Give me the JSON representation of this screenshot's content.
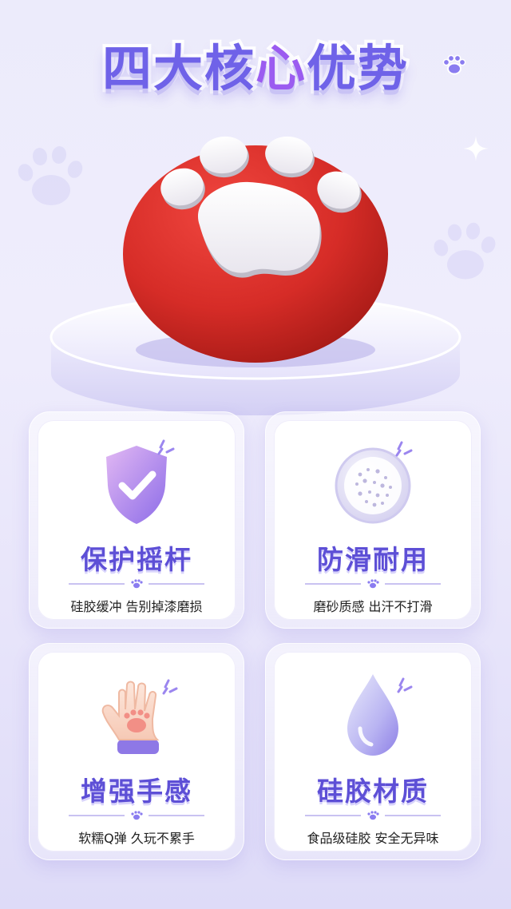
{
  "title": {
    "part1": "四大核",
    "highlight": "心",
    "part2": "优势"
  },
  "colors": {
    "accent": "#6f62e8",
    "highlight": "#9b5cf0",
    "product_red": "#d92f2b",
    "paw_pad": "#ffffff"
  },
  "features": [
    {
      "icon": "shield-check-icon",
      "title": "保护摇杆",
      "subtitle": "硅胶缓冲 告别掉漆磨损"
    },
    {
      "icon": "textured-disc-icon",
      "title": "防滑耐用",
      "subtitle": "磨砂质感 出汗不打滑"
    },
    {
      "icon": "paw-glove-icon",
      "title": "增强手感",
      "subtitle": "软糯Q弹 久玩不累手"
    },
    {
      "icon": "water-drop-icon",
      "title": "硅胶材质",
      "subtitle": "食品级硅胶 安全无异味"
    }
  ]
}
